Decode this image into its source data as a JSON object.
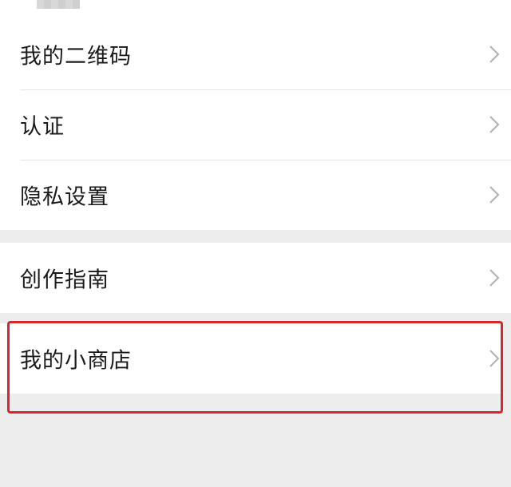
{
  "menu": {
    "group1": [
      {
        "label": "我的二维码"
      },
      {
        "label": "认证"
      },
      {
        "label": "隐私设置"
      }
    ],
    "group2": [
      {
        "label": "创作指南"
      }
    ],
    "group3": [
      {
        "label": "我的小商店"
      }
    ]
  },
  "icons": {
    "row_chevron": "chevron-right-icon"
  },
  "colors": {
    "page_background": "#ededed",
    "row_background": "#ffffff",
    "text": "#1a1a1a",
    "chevron": "#b2b2b2",
    "highlight_border": "#d4282d"
  }
}
